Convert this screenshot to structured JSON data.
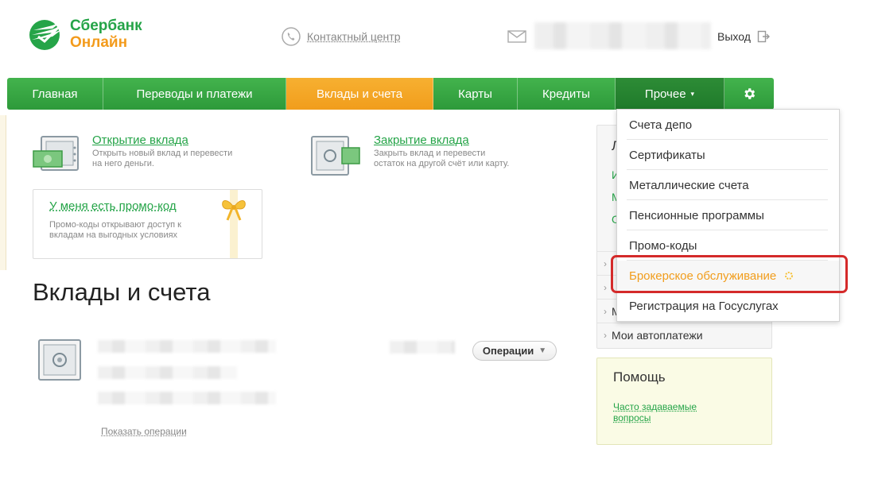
{
  "header": {
    "logo_line1": "Сбербанк",
    "logo_line2": "Онлайн",
    "contact_label": "Контактный центр",
    "exit_label": "Выход"
  },
  "nav": {
    "items": [
      {
        "label": "Главная"
      },
      {
        "label": "Переводы и платежи"
      },
      {
        "label": "Вклады и счета",
        "active": true
      },
      {
        "label": "Карты"
      },
      {
        "label": "Кредиты"
      },
      {
        "label": "Прочее"
      }
    ],
    "settings_icon": "gear-icon"
  },
  "actions": {
    "open": {
      "title": "Открытие вклада",
      "description": "Открыть новый вклад и перевести на него деньги."
    },
    "close": {
      "title": "Закрытие вклада",
      "description": "Закрыть вклад и перевести остаток на другой счёт или карту."
    }
  },
  "promo": {
    "title": "У меня есть промо-код",
    "description": "Промо-коды открывают доступ к вкладам на выгодных условиях"
  },
  "main": {
    "page_title": "Вклады и счета",
    "operations_button": "Операции",
    "show_operations": "Показать операции"
  },
  "side_panel": {
    "fragments": [
      "Л",
      "И",
      "М",
      "О"
    ],
    "row_fragments": [
      "М"
    ],
    "bottom_item": "Мои автоплатежи"
  },
  "help": {
    "title": "Помощь",
    "link": "Часто задаваемые вопросы"
  },
  "dropdown": {
    "items": [
      "Счета депо",
      "Сертификаты",
      "Металлические счета",
      "Пенсионные программы",
      "Промо-коды",
      "Брокерское обслуживание",
      "Регистрация на Госуслугах"
    ],
    "highlighted_index": 5
  },
  "colors": {
    "brand_green": "#25a448",
    "accent_orange": "#f19d1c",
    "highlight_red": "#d42a2a"
  }
}
